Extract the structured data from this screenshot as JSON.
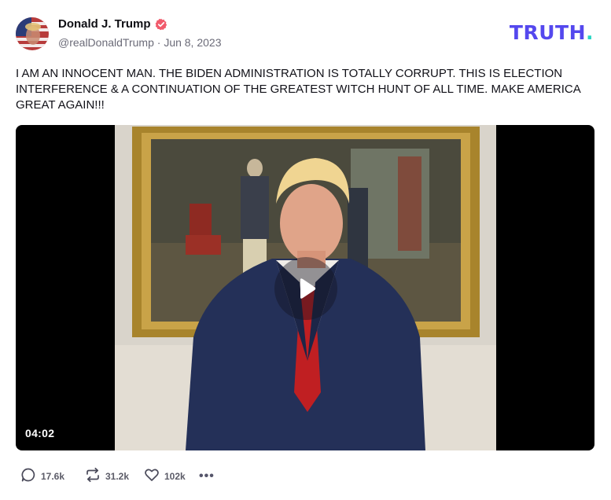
{
  "post": {
    "author": {
      "display_name": "Donald J. Trump",
      "handle": "@realDonaldTrump",
      "date": "Jun 8, 2023",
      "separator": "·",
      "verified_icon": "verified-badge-icon"
    },
    "brand": {
      "logo_text": "TRUTH",
      "logo_dot": ".",
      "color": "#5448ee",
      "dot_color": "#2ad6c4"
    },
    "text": "I AM AN INNOCENT MAN. THE BIDEN ADMINISTRATION IS TOTALLY CORRUPT. THIS IS ELECTION INTERFERENCE & A CONTINUATION OF THE GREATEST WITCH HUNT OF ALL TIME. MAKE AMERICA GREAT AGAIN!!!",
    "video": {
      "duration": "04:02",
      "play_icon": "play-icon"
    },
    "actions": {
      "replies": "17.6k",
      "reposts": "31.2k",
      "likes": "102k",
      "more": "•••"
    }
  }
}
